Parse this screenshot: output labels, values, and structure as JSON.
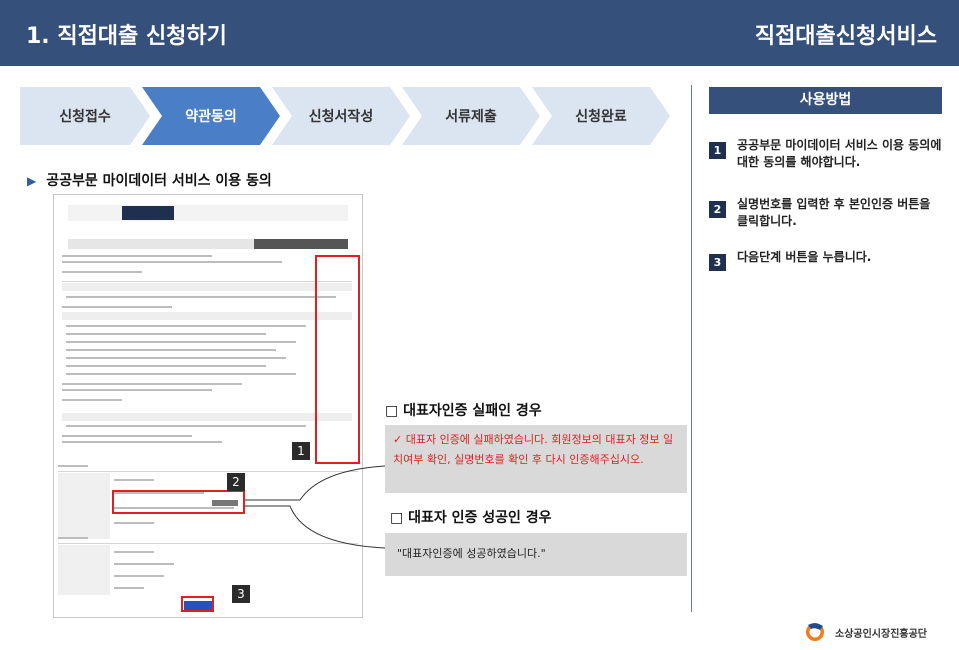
{
  "header": {
    "title": "1. 직접대출 신청하기",
    "service": "직접대출신청서비스"
  },
  "steps": [
    {
      "label": "신청접수",
      "active": false
    },
    {
      "label": "약관동의",
      "active": true
    },
    {
      "label": "신청서작성",
      "active": false
    },
    {
      "label": "서류제출",
      "active": false
    },
    {
      "label": "신청완료",
      "active": false
    }
  ],
  "section_title": "공공부문 마이데이터 서비스 이용 동의",
  "sidebar": {
    "title": "사용방법",
    "items": [
      {
        "num": "1",
        "text": "공공부문 마이데이터 서비스 이용 동의에 대한 동의를 해야합니다."
      },
      {
        "num": "2",
        "text": "실명번호를 입력한 후 본인인증 버튼을 클릭합니다."
      },
      {
        "num": "3",
        "text": "다음단계 버튼을 누릅니다."
      }
    ]
  },
  "callouts": {
    "one": "1",
    "two": "2",
    "three": "3"
  },
  "fail": {
    "title": "□ 대표자인증 실패인 경우",
    "message": "✓  대표자 인증에 실패하였습니다. 회원정보의 대표자 정보 일치여부 확인, 실명번호를 확인 후 다시 인증해주십시오."
  },
  "success": {
    "title": "□ 대표자 인증 성공인 경우",
    "message": "\"대표자인증에 성공하였습니다.\""
  },
  "logo": {
    "text": "소상공인시장진흥공단"
  },
  "colors": {
    "header": "#35507b",
    "active_step": "#4a7fc8",
    "inactive_step": "#dbe4f1",
    "highlight": "#e02020"
  }
}
